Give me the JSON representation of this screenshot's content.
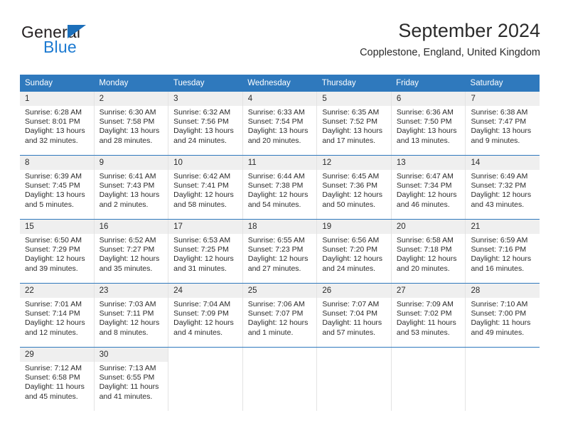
{
  "logo": {
    "word_one": "General",
    "word_two": "Blue",
    "icon": "triangle-icon"
  },
  "header": {
    "title": "September 2024",
    "subtitle": "Copplestone, England, United Kingdom"
  },
  "theme": {
    "accent": "#2f79bd",
    "logo_blue": "#1c7ad1",
    "daynum_band": "#efefef",
    "cell_border": "#e3e3e3",
    "text": "#2b2b2b"
  },
  "labels": {
    "sunrise_prefix": "Sunrise:",
    "sunset_prefix": "Sunset:",
    "daylight_prefix": "Daylight:"
  },
  "calendar": {
    "day_headers": [
      "Sunday",
      "Monday",
      "Tuesday",
      "Wednesday",
      "Thursday",
      "Friday",
      "Saturday"
    ],
    "weeks": [
      [
        {
          "day": "1",
          "sunrise": "Sunrise: 6:28 AM",
          "sunset": "Sunset: 8:01 PM",
          "daylight": "Daylight: 13 hours and 32 minutes."
        },
        {
          "day": "2",
          "sunrise": "Sunrise: 6:30 AM",
          "sunset": "Sunset: 7:58 PM",
          "daylight": "Daylight: 13 hours and 28 minutes."
        },
        {
          "day": "3",
          "sunrise": "Sunrise: 6:32 AM",
          "sunset": "Sunset: 7:56 PM",
          "daylight": "Daylight: 13 hours and 24 minutes."
        },
        {
          "day": "4",
          "sunrise": "Sunrise: 6:33 AM",
          "sunset": "Sunset: 7:54 PM",
          "daylight": "Daylight: 13 hours and 20 minutes."
        },
        {
          "day": "5",
          "sunrise": "Sunrise: 6:35 AM",
          "sunset": "Sunset: 7:52 PM",
          "daylight": "Daylight: 13 hours and 17 minutes."
        },
        {
          "day": "6",
          "sunrise": "Sunrise: 6:36 AM",
          "sunset": "Sunset: 7:50 PM",
          "daylight": "Daylight: 13 hours and 13 minutes."
        },
        {
          "day": "7",
          "sunrise": "Sunrise: 6:38 AM",
          "sunset": "Sunset: 7:47 PM",
          "daylight": "Daylight: 13 hours and 9 minutes."
        }
      ],
      [
        {
          "day": "8",
          "sunrise": "Sunrise: 6:39 AM",
          "sunset": "Sunset: 7:45 PM",
          "daylight": "Daylight: 13 hours and 5 minutes."
        },
        {
          "day": "9",
          "sunrise": "Sunrise: 6:41 AM",
          "sunset": "Sunset: 7:43 PM",
          "daylight": "Daylight: 13 hours and 2 minutes."
        },
        {
          "day": "10",
          "sunrise": "Sunrise: 6:42 AM",
          "sunset": "Sunset: 7:41 PM",
          "daylight": "Daylight: 12 hours and 58 minutes."
        },
        {
          "day": "11",
          "sunrise": "Sunrise: 6:44 AM",
          "sunset": "Sunset: 7:38 PM",
          "daylight": "Daylight: 12 hours and 54 minutes."
        },
        {
          "day": "12",
          "sunrise": "Sunrise: 6:45 AM",
          "sunset": "Sunset: 7:36 PM",
          "daylight": "Daylight: 12 hours and 50 minutes."
        },
        {
          "day": "13",
          "sunrise": "Sunrise: 6:47 AM",
          "sunset": "Sunset: 7:34 PM",
          "daylight": "Daylight: 12 hours and 46 minutes."
        },
        {
          "day": "14",
          "sunrise": "Sunrise: 6:49 AM",
          "sunset": "Sunset: 7:32 PM",
          "daylight": "Daylight: 12 hours and 43 minutes."
        }
      ],
      [
        {
          "day": "15",
          "sunrise": "Sunrise: 6:50 AM",
          "sunset": "Sunset: 7:29 PM",
          "daylight": "Daylight: 12 hours and 39 minutes."
        },
        {
          "day": "16",
          "sunrise": "Sunrise: 6:52 AM",
          "sunset": "Sunset: 7:27 PM",
          "daylight": "Daylight: 12 hours and 35 minutes."
        },
        {
          "day": "17",
          "sunrise": "Sunrise: 6:53 AM",
          "sunset": "Sunset: 7:25 PM",
          "daylight": "Daylight: 12 hours and 31 minutes."
        },
        {
          "day": "18",
          "sunrise": "Sunrise: 6:55 AM",
          "sunset": "Sunset: 7:23 PM",
          "daylight": "Daylight: 12 hours and 27 minutes."
        },
        {
          "day": "19",
          "sunrise": "Sunrise: 6:56 AM",
          "sunset": "Sunset: 7:20 PM",
          "daylight": "Daylight: 12 hours and 24 minutes."
        },
        {
          "day": "20",
          "sunrise": "Sunrise: 6:58 AM",
          "sunset": "Sunset: 7:18 PM",
          "daylight": "Daylight: 12 hours and 20 minutes."
        },
        {
          "day": "21",
          "sunrise": "Sunrise: 6:59 AM",
          "sunset": "Sunset: 7:16 PM",
          "daylight": "Daylight: 12 hours and 16 minutes."
        }
      ],
      [
        {
          "day": "22",
          "sunrise": "Sunrise: 7:01 AM",
          "sunset": "Sunset: 7:14 PM",
          "daylight": "Daylight: 12 hours and 12 minutes."
        },
        {
          "day": "23",
          "sunrise": "Sunrise: 7:03 AM",
          "sunset": "Sunset: 7:11 PM",
          "daylight": "Daylight: 12 hours and 8 minutes."
        },
        {
          "day": "24",
          "sunrise": "Sunrise: 7:04 AM",
          "sunset": "Sunset: 7:09 PM",
          "daylight": "Daylight: 12 hours and 4 minutes."
        },
        {
          "day": "25",
          "sunrise": "Sunrise: 7:06 AM",
          "sunset": "Sunset: 7:07 PM",
          "daylight": "Daylight: 12 hours and 1 minute."
        },
        {
          "day": "26",
          "sunrise": "Sunrise: 7:07 AM",
          "sunset": "Sunset: 7:04 PM",
          "daylight": "Daylight: 11 hours and 57 minutes."
        },
        {
          "day": "27",
          "sunrise": "Sunrise: 7:09 AM",
          "sunset": "Sunset: 7:02 PM",
          "daylight": "Daylight: 11 hours and 53 minutes."
        },
        {
          "day": "28",
          "sunrise": "Sunrise: 7:10 AM",
          "sunset": "Sunset: 7:00 PM",
          "daylight": "Daylight: 11 hours and 49 minutes."
        }
      ],
      [
        {
          "day": "29",
          "sunrise": "Sunrise: 7:12 AM",
          "sunset": "Sunset: 6:58 PM",
          "daylight": "Daylight: 11 hours and 45 minutes."
        },
        {
          "day": "30",
          "sunrise": "Sunrise: 7:13 AM",
          "sunset": "Sunset: 6:55 PM",
          "daylight": "Daylight: 11 hours and 41 minutes."
        },
        {
          "day": "",
          "sunrise": "",
          "sunset": "",
          "daylight": ""
        },
        {
          "day": "",
          "sunrise": "",
          "sunset": "",
          "daylight": ""
        },
        {
          "day": "",
          "sunrise": "",
          "sunset": "",
          "daylight": ""
        },
        {
          "day": "",
          "sunrise": "",
          "sunset": "",
          "daylight": ""
        },
        {
          "day": "",
          "sunrise": "",
          "sunset": "",
          "daylight": ""
        }
      ]
    ]
  }
}
